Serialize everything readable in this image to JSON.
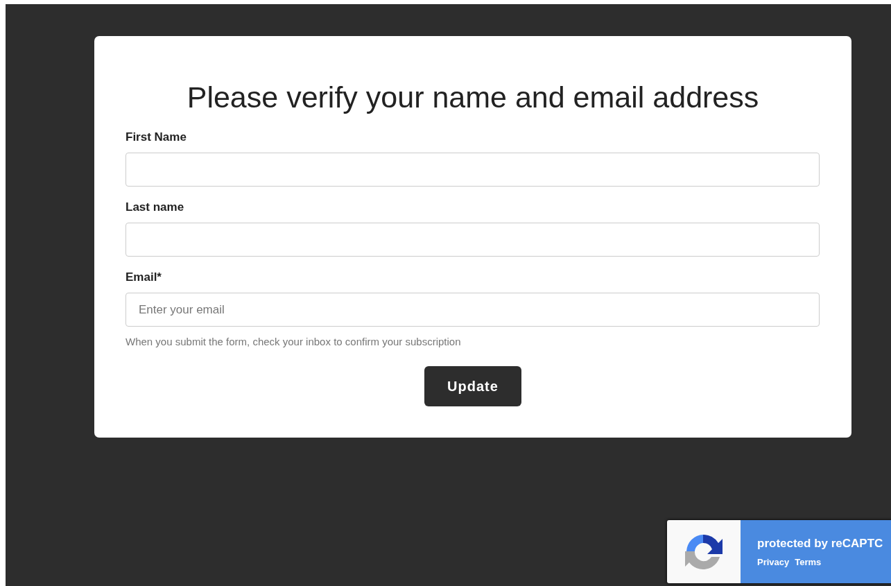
{
  "form": {
    "title": "Please verify your name and email address",
    "fields": [
      {
        "label": "First Name"
      },
      {
        "label": "Last name"
      },
      {
        "label": "Email*",
        "placeholder": "Enter your email",
        "help": "When you submit the form, check your inbox to confirm your subscription"
      }
    ],
    "submit": "Update"
  },
  "recaptcha_badge": {
    "text": "protected by reCAPTC",
    "links": [
      "Privacy",
      "Terms"
    ]
  }
}
